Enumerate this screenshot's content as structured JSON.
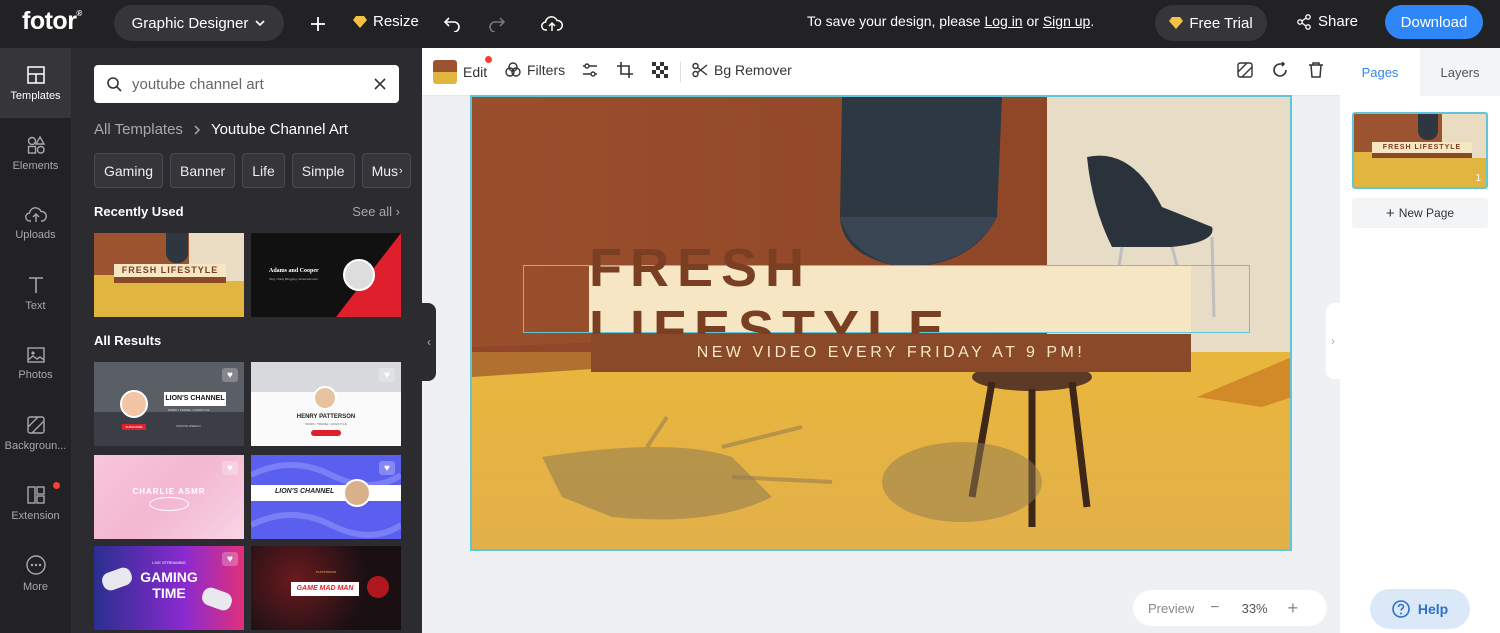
{
  "topbar": {
    "logo": "fotor",
    "logo_mark": "®",
    "project_type": "Graphic Designer",
    "resize_label": "Resize",
    "notice_prefix": "To save your design, please",
    "login": "Log in",
    "or": "or",
    "signup": "Sign up",
    "notice_suffix": ".",
    "free_trial": "Free Trial",
    "share": "Share",
    "download": "Download"
  },
  "rail": {
    "items": [
      {
        "label": "Templates",
        "icon": "templates-icon"
      },
      {
        "label": "Elements",
        "icon": "elements-icon"
      },
      {
        "label": "Uploads",
        "icon": "upload-icon"
      },
      {
        "label": "Text",
        "icon": "text-icon"
      },
      {
        "label": "Photos",
        "icon": "photo-icon"
      },
      {
        "label": "Backgroun...",
        "icon": "background-icon"
      },
      {
        "label": "Extension",
        "icon": "extension-icon"
      },
      {
        "label": "More",
        "icon": "more-icon"
      }
    ]
  },
  "panel": {
    "search_value": "youtube channel art",
    "crumb_root": "All Templates",
    "crumb_current": "Youtube Channel Art",
    "chips": [
      "Gaming",
      "Banner",
      "Life",
      "Simple",
      "Mus"
    ],
    "recently_used": "Recently Used",
    "see_all": "See all",
    "all_results": "All Results",
    "thumbs": {
      "t1_title": "FRESH LIFESTYLE",
      "t2_title": "Adams and Cooper",
      "t2_sub": "Vlog / Daily Blogging / Entertainment",
      "t3_title": "LION'S CHANNEL",
      "t3_sub": "WORK / TRAVEL / LIFESTYLE",
      "t3_btn": "SUBSCRIBE",
      "t3_foot": "UPDATE WEEKLY",
      "t4_title": "HENRY PATTERSON",
      "t4_sub": "WORK / TRAVEL / LIFESTYLE",
      "t5_title": "CHARLIE ASMR",
      "t6_title": "LION'S CHANNEL",
      "t7_top": "LIVE STREAMING",
      "t7_title1": "GAMING",
      "t7_title2": "TIME",
      "t8_top": "PLAYSTATION",
      "t8_title": "GAME MAD MAN"
    }
  },
  "editbar": {
    "edit": "Edit",
    "filters": "Filters",
    "bg_remover": "Bg Remover"
  },
  "canvas": {
    "headline": "FRESH LIFESTYLE",
    "subline": "NEW VIDEO EVERY FRIDAY AT 9 PM!"
  },
  "zoom": {
    "preview": "Preview",
    "minus": "−",
    "level": "33%",
    "plus": "+"
  },
  "right_panel": {
    "tab_pages": "Pages",
    "tab_layers": "Layers",
    "page_number": "1",
    "thumb_title": "FRESH LIFESTYLE",
    "new_page": "New Page",
    "help": "Help"
  },
  "colors": {
    "accent": "#2f86f6",
    "dark_bg": "#222225",
    "panel_bg": "#2c2c30",
    "headline_brown": "#7a3e22",
    "banner_cream": "#f6e6c4",
    "sub_banner": "#8a4a2a",
    "selection": "#5fc6d8"
  }
}
